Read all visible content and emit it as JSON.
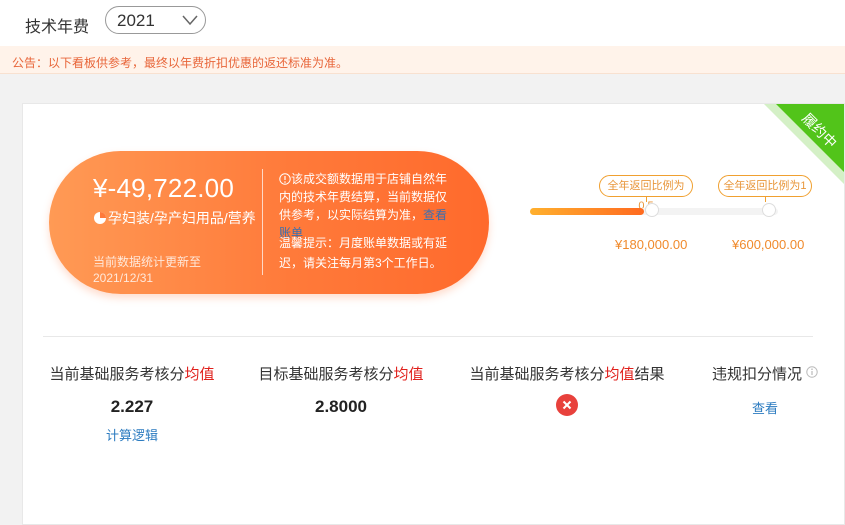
{
  "header": {
    "title": "技术年费",
    "year_selected": "2021"
  },
  "notice": {
    "text": "公告：以下看板供参考，最终以年费折扣优惠的返还标准为准。"
  },
  "card": {
    "status_ribbon": "履约中",
    "amount": "¥-49,722.00",
    "category": "孕妇装/孕产妇用品/营养",
    "update_label": "当前数据统计更新至",
    "update_date": "2021/12/31",
    "note_text": "该成交额数据用于店铺自然年内的技术年费结算，当前数据仅供参考，以实际结算为准，",
    "note_link": "查看账单",
    "tip_text": "温馨提示：月度账单数据或有延迟，请关注每月第3个工作日。",
    "progress_fraction": 0.46,
    "milestones": [
      {
        "label": "全年返回比例为0.5",
        "amount": "¥180,000.00"
      },
      {
        "label": "全年返回比例为1",
        "amount": "¥600,000.00"
      }
    ]
  },
  "metrics": {
    "current": {
      "label_pre": "当前基础服务考核分",
      "label_hl": "均值",
      "value": "2.227",
      "link": "计算逻辑"
    },
    "target": {
      "label_pre": "目标基础服务考核分",
      "label_hl": "均值",
      "value": "2.8000"
    },
    "result": {
      "label_pre": "当前基础服务考核分",
      "label_hl": "均值",
      "label_post": "结果",
      "status": "fail"
    },
    "violation": {
      "label": "违规扣分情况",
      "link": "查看"
    }
  },
  "colors": {
    "accent_orange": "#ff7a3a",
    "ribbon_green": "#52c41a",
    "highlight_red": "#e0201c",
    "link_blue": "#2b7bc0"
  },
  "icons": [
    "chevron-down-icon",
    "pie-icon",
    "info-icon",
    "close-circle-icon"
  ]
}
